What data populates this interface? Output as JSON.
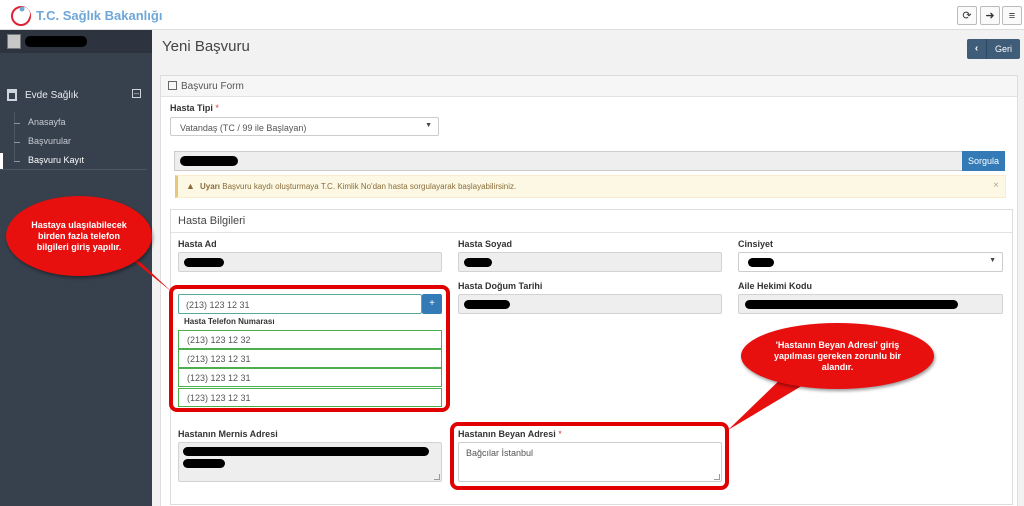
{
  "header": {
    "logo_text": "T.C. Sağlık Bakanlığı",
    "icons": [
      "refresh-icon",
      "sign-out-icon",
      "menu-icon"
    ]
  },
  "sidebar": {
    "section_label": "Evde Sağlık",
    "items": [
      {
        "label": "Anasayfa",
        "active": false
      },
      {
        "label": "Başvurular",
        "active": false
      },
      {
        "label": "Başvuru Kayıt",
        "active": true
      }
    ]
  },
  "page": {
    "title": "Yeni Başvuru",
    "back_label": "Geri"
  },
  "form": {
    "panel_title": "Başvuru Form",
    "hasta_tipi_label": "Hasta Tipi",
    "required_mark": "*",
    "hasta_tipi_value": "Vatandaş (TC / 99 ile Başlayan)",
    "query_button": "Sorgula",
    "alert_strong": "Uyarı",
    "alert_text": "Başvuru kaydı oluşturmaya T.C. Kimlik No'dan hasta sorgulayarak başlayabilirsiniz.",
    "section_title": "Hasta Bilgileri",
    "labels": {
      "hasta_ad": "Hasta Ad",
      "hasta_soyad": "Hasta Soyad",
      "cinsiyet": "Cinsiyet",
      "dogum_tarihi": "Hasta Doğum Tarihi",
      "aile_hekimi": "Aile Hekimi Kodu",
      "telefon": "Hasta Telefon Numarası",
      "mernis_adres": "Hastanın Mernis Adresi",
      "beyan_adres": "Hastanın Beyan Adresi"
    },
    "phone_input_value": "(213) 123 12 31",
    "phone_add_label": "+",
    "phones": [
      "(213) 123 12 32",
      "(213) 123 12 31",
      "(123) 123 12 31",
      "(123) 123 12 31"
    ],
    "beyan_adres_value": "Bağcılar İstanbul"
  },
  "callouts": {
    "phone_note": "Hastaya ulaşılabilecek birden fazla telefon bilgileri giriş yapılır.",
    "address_note": "'Hastanın Beyan Adresi' giriş yapılması gereken zorunlu bir alandır."
  },
  "colors": {
    "sidebar_bg": "#37404d",
    "primary": "#337ab7",
    "back_button": "#3f5d78",
    "callout_red": "#e00000",
    "success_border": "#4cae4c"
  }
}
